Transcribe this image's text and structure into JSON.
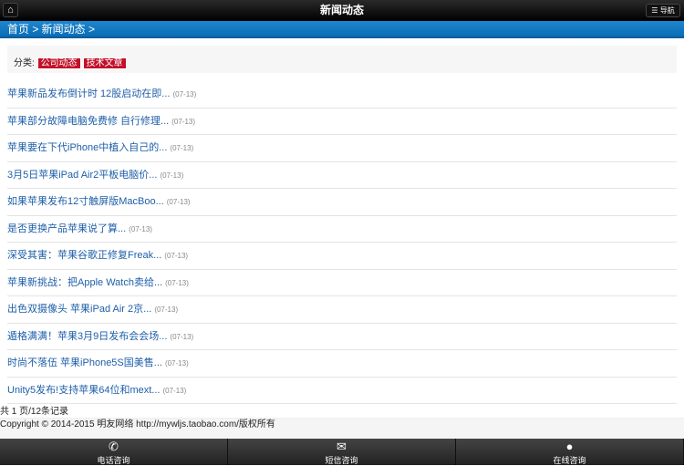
{
  "header": {
    "title": "新闻动态",
    "nav_label": "导航"
  },
  "breadcrumb": "首页 > 新闻动态 >",
  "category": {
    "label": "分类:",
    "tags": [
      "公司动态",
      "技术文章"
    ]
  },
  "items": [
    {
      "title": "苹果新品发布倒计时 12股启动在即...",
      "date": "(07-13)"
    },
    {
      "title": "苹果部分故障电脑免费修 自行修理...",
      "date": "(07-13)"
    },
    {
      "title": "苹果要在下代iPhone中植入自己的...",
      "date": "(07-13)"
    },
    {
      "title": "3月5日苹果iPad Air2平板电脑价...",
      "date": "(07-13)"
    },
    {
      "title": "如果苹果发布12寸触屏版MacBoo...",
      "date": "(07-13)"
    },
    {
      "title": "是否更换产品苹果说了算...",
      "date": "(07-13)"
    },
    {
      "title": "深受其害：苹果谷歌正修复Freak...",
      "date": "(07-13)"
    },
    {
      "title": "苹果新挑战：把Apple Watch卖给...",
      "date": "(07-13)"
    },
    {
      "title": "出色双摄像头 苹果iPad Air 2京...",
      "date": "(07-13)"
    },
    {
      "title": "遁格满满！苹果3月9日发布会会场...",
      "date": "(07-13)"
    },
    {
      "title": "时尚不落伍 苹果iPhone5S国美售...",
      "date": "(07-13)"
    },
    {
      "title": "Unity5发布!支持苹果64位和mext...",
      "date": "(07-13)"
    }
  ],
  "pager": "共 1 页/12条记录",
  "footer": "Copyright © 2014-2015 明友网络 http://mywljs.taobao.com/版权所有",
  "bottom": [
    {
      "label": "电话咨询",
      "icon": "phone-icon"
    },
    {
      "label": "短信咨询",
      "icon": "mail-icon"
    },
    {
      "label": "在线咨询",
      "icon": "chat-icon"
    }
  ]
}
